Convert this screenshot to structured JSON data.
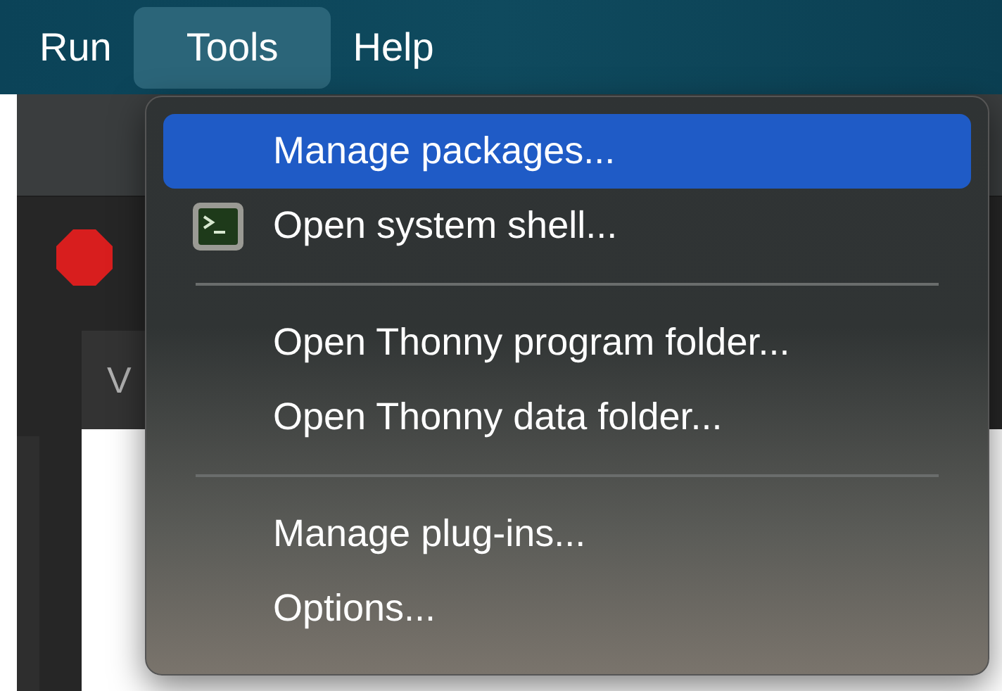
{
  "menubar": [
    {
      "label": "Run",
      "selected": false
    },
    {
      "label": "Tools",
      "selected": true
    },
    {
      "label": "Help",
      "selected": false
    }
  ],
  "background": {
    "tab_label": "V"
  },
  "menu": {
    "items": [
      {
        "kind": "item",
        "label": "Manage packages...",
        "selected": true
      },
      {
        "kind": "terminal_item",
        "label": "Open system shell...",
        "selected": false
      },
      {
        "kind": "separator"
      },
      {
        "kind": "item",
        "label": "Open Thonny program folder...",
        "selected": false
      },
      {
        "kind": "item",
        "label": "Open Thonny data folder...",
        "selected": false
      },
      {
        "kind": "separator"
      },
      {
        "kind": "item",
        "label": "Manage plug-ins...",
        "selected": false
      },
      {
        "kind": "item",
        "label": "Options...",
        "selected": false
      }
    ]
  }
}
